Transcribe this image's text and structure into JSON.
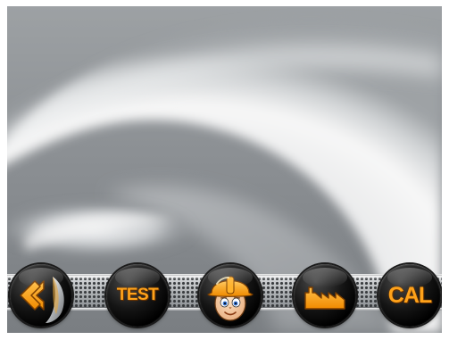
{
  "screen": {
    "background_color": "#8f9396",
    "accent_color": "#ffa21a"
  },
  "toolbar": {
    "buttons": [
      {
        "name": "back-button",
        "icon": "back-arrow-icon",
        "label": ""
      },
      {
        "name": "test-button",
        "icon": "",
        "label": "TEST"
      },
      {
        "name": "operator-button",
        "icon": "worker-icon",
        "label": ""
      },
      {
        "name": "factory-button",
        "icon": "factory-icon",
        "label": ""
      },
      {
        "name": "cal-button",
        "icon": "",
        "label": "CAL"
      }
    ]
  }
}
